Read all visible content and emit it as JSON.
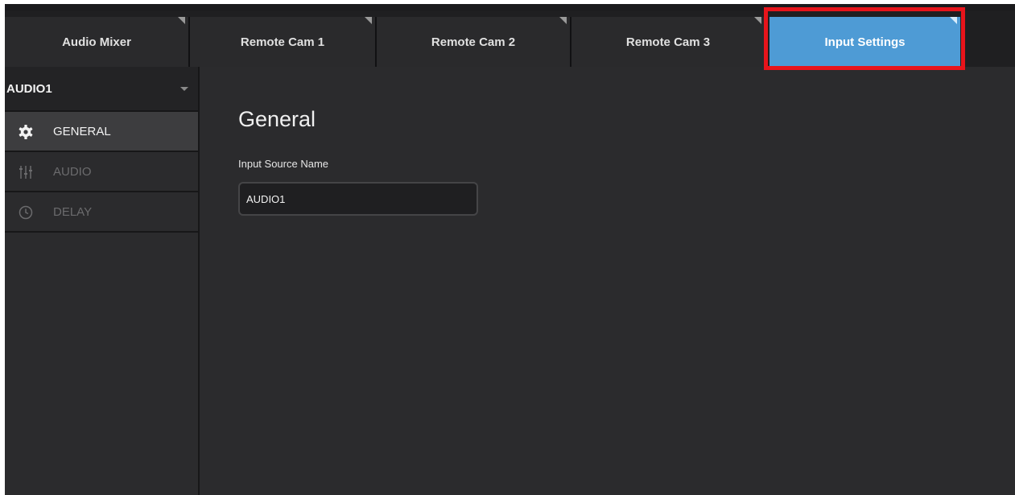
{
  "tabs": [
    {
      "label": "Audio Mixer",
      "active": false
    },
    {
      "label": "Remote Cam 1",
      "active": false
    },
    {
      "label": "Remote Cam 2",
      "active": false
    },
    {
      "label": "Remote Cam 3",
      "active": false
    },
    {
      "label": "Input Settings",
      "active": true
    }
  ],
  "sidebar": {
    "source_select": {
      "value": "AUDIO1",
      "icon": "chevron-down-icon"
    },
    "items": [
      {
        "label": "GENERAL",
        "icon": "gear-icon",
        "active": true
      },
      {
        "label": "AUDIO",
        "icon": "mixer-sliders-icon",
        "active": false
      },
      {
        "label": "DELAY",
        "icon": "clock-icon",
        "active": false
      }
    ]
  },
  "main": {
    "section_title": "General",
    "input_source_label": "Input Source Name",
    "input_source_value": "AUDIO1"
  },
  "colors": {
    "active_tab": "#4e9bd5",
    "highlight": "#e8141b",
    "background": "#2b2b2d"
  }
}
